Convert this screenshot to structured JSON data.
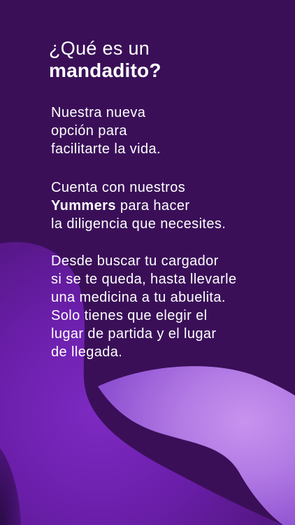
{
  "title": {
    "line1": "¿Qué es un",
    "line2": "mandadito?"
  },
  "paragraph1": {
    "lines": [
      "Nuestra nueva",
      "opción para",
      "facilitarte la vida."
    ]
  },
  "paragraph2": {
    "line1": "Cuenta con nuestros",
    "line2_bold": "Yummers",
    "line2_rest": " para hacer",
    "line3": "la diligencia que necesites."
  },
  "paragraph3": {
    "lines": [
      "Desde buscar tu cargador",
      "si se te queda, hasta llevarle",
      "una medicina a tu abuelita.",
      "Solo tienes que elegir el",
      "lugar de partida y el lugar",
      "de llegada."
    ]
  },
  "colors": {
    "background": "#3a0f58",
    "blob_dark": "#6b1fa8",
    "blob_light": "#b87fe6",
    "text": "#ffffff"
  }
}
